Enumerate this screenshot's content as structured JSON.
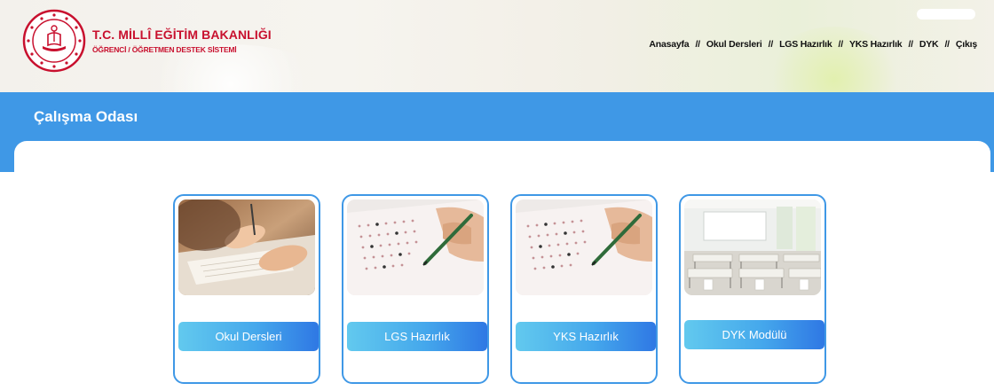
{
  "header": {
    "ministry_title": "T.C. MİLLÎ EĞİTİM BAKANLIĞI",
    "system_subtitle": "ÖĞRENCİ / ÖĞRETMEN DESTEK SİSTEMİ",
    "logo_icon": "meb-emblem-icon"
  },
  "nav": {
    "separator": "//",
    "items": [
      {
        "label": "Anasayfa"
      },
      {
        "label": "Okul Dersleri"
      },
      {
        "label": "LGS Hazırlık"
      },
      {
        "label": "YKS Hazırlık"
      },
      {
        "label": "DYK"
      },
      {
        "label": "Çıkış"
      }
    ]
  },
  "section": {
    "title": "Çalışma Odası"
  },
  "cards": [
    {
      "button_label": "Okul Dersleri",
      "image": "students-writing-image"
    },
    {
      "button_label": "LGS Hazırlık",
      "image": "answer-sheet-image"
    },
    {
      "button_label": "YKS Hazırlık",
      "image": "answer-sheet-image"
    },
    {
      "button_label": "DYK Modülü",
      "image": "classroom-image"
    }
  ],
  "colors": {
    "brand_red": "#c8102e",
    "band_blue": "#3f98e6",
    "button_gradient_start": "#62c9ee",
    "button_gradient_end": "#2f78e4"
  }
}
